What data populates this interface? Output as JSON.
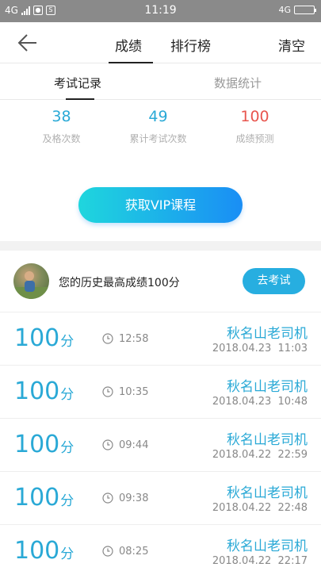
{
  "status_bar": {
    "network": "4G",
    "time": "11:19",
    "network_right": "4G"
  },
  "header": {
    "tabs": [
      "成绩",
      "排行榜"
    ],
    "clear_label": "清空"
  },
  "subtabs": [
    "考试记录",
    "数据统计"
  ],
  "stats": [
    {
      "value": "38",
      "label": "及格次数",
      "color": "#2aa9d6"
    },
    {
      "value": "49",
      "label": "累计考试次数",
      "color": "#2aa9d6"
    },
    {
      "value": "100",
      "label": "成绩预测",
      "color": "#e8554e"
    }
  ],
  "vip_button": "获取VIP课程",
  "best": {
    "text": "您的历史最高成绩100分",
    "button": "去考试"
  },
  "records": [
    {
      "score": "100",
      "unit": "分",
      "duration": "12:58",
      "name": "秋名山老司机",
      "date": "2018.04.23  11:03"
    },
    {
      "score": "100",
      "unit": "分",
      "duration": "10:35",
      "name": "秋名山老司机",
      "date": "2018.04.23  10:48"
    },
    {
      "score": "100",
      "unit": "分",
      "duration": "09:44",
      "name": "秋名山老司机",
      "date": "2018.04.22  22:59"
    },
    {
      "score": "100",
      "unit": "分",
      "duration": "09:38",
      "name": "秋名山老司机",
      "date": "2018.04.22  22:48"
    },
    {
      "score": "100",
      "unit": "分",
      "duration": "08:25",
      "name": "秋名山老司机",
      "date": "2018.04.22  22:17"
    }
  ]
}
